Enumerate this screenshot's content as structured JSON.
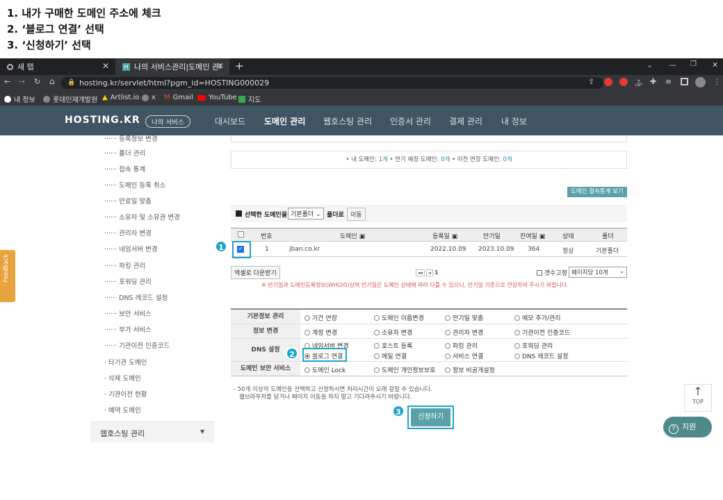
{
  "instructions": [
    "1. 내가 구매한 도메인 주소에 체크",
    "2. ‘블로그 연결’ 선택",
    "3. ‘신청하기’ 선택"
  ],
  "browser": {
    "tabs": [
      {
        "title": "새 탭"
      },
      {
        "title": "나의 서비스관리|도메인 관리|보"
      }
    ],
    "url": "hosting.kr/servlet/html?pgm_id=HOSTING000029",
    "bookmarks": [
      "내 정보",
      "롯데인재개발원",
      "Artlist.io",
      "x",
      "Gmail",
      "YouTube",
      "지도"
    ]
  },
  "site": {
    "logo": "HOSTING.KR",
    "logo_tag": "나의 서비스",
    "nav": [
      "대시보드",
      "도메인 관리",
      "웹호스팅 관리",
      "인증서 관리",
      "결제 관리",
      "내 정보"
    ],
    "nav_active": "도메인 관리"
  },
  "sidebar": {
    "items": [
      "······ 등록정보 변경",
      "······ 폴더 관리",
      "······ 접속 통계",
      "······ 도메인 등록 취소",
      "······ 만료일 맞춤",
      "······ 소유자 및 소유권 변경",
      "······ 관리자 변경",
      "······ 네임서버 변경",
      "······ 파킹 관리",
      "······ 포워딩 관리",
      "······ DNS 레코드 설정",
      "······ 보안 서비스",
      "······ 부가 서비스",
      "······ 기관이전 인증코드",
      "타기관 도메인",
      "삭제 도메인",
      "기관이전 현황",
      "예약 도메인"
    ],
    "bottom": "웹호스팅 관리"
  },
  "feedback_tab": "Feedback",
  "summary": {
    "prefix": "• 내 도메인: ",
    "count1": "1개",
    "mid": " • 만기 예정 도메인: ",
    "count2": "0개",
    "mid2": " • 이전 연장 도메인: ",
    "count3": "0개"
  },
  "stats_button": "도메인 접속통계 보기",
  "folder_bar": {
    "label": "선택한 도메인을",
    "select": "기본폴더",
    "suffix": "폴더로",
    "move": "이동"
  },
  "table": {
    "headers": [
      "번호",
      "도메인",
      "등록일",
      "만기일",
      "잔여일",
      "상태",
      "폴더"
    ],
    "rows": [
      {
        "no": "1",
        "domain": "jban.co.kr",
        "reg": "2022.10.09",
        "exp": "2023.10.09",
        "remain": "364",
        "status": "정상",
        "folder": "기본폴더"
      }
    ]
  },
  "excel_button": "엑셀로 다운받기",
  "pager": {
    "page": "1"
  },
  "fix_count": "갯수고정",
  "per_page": "페이지당 10개",
  "notice": "※ 만기일과 도메인등록정보(WHOIS)상의 만기일은 도메인 상태에 따라 다를 수 있으니, 만기일 기준으로 연장하여 주시기 바랍니다.",
  "services": [
    {
      "label": "기본정보 관리",
      "options": [
        "기간 연장",
        "도메인 이름변경",
        "만기일 맞춤",
        "메모 추가/관리"
      ]
    },
    {
      "label": "정보 변경",
      "options": [
        "계정 변경",
        "소유자 변경",
        "관리자 변경",
        "기관이전 인증코드"
      ]
    },
    {
      "label": "DNS 설정",
      "options": [
        "네임서버 변경",
        "호스트 등록",
        "파킹 관리",
        "포워딩 관리",
        "블로그 연결",
        "메일 연결",
        "서비스 연결",
        "DNS 레코드 설정"
      ]
    },
    {
      "label": "도메인 보안 서비스",
      "options": [
        "도메인 Lock",
        "도메인 개인정보보호",
        "정보 비공개설정"
      ]
    }
  ],
  "selected_option": "블로그 연결",
  "footnote": [
    "- 50개 이상의 도메인을 선택하고 신청하시면 처리시간이 오래 걸릴 수 있습니다.",
    "웹브라우저를 닫거나 페이지 이동을 하지 말고 기다려주시기 바랍니다."
  ],
  "submit": "신청하기",
  "top_button": "TOP",
  "support_button": "지원",
  "badges": [
    "1",
    "2",
    "3"
  ],
  "colors": {
    "nav_bg": "#3f5563",
    "accent": "#5aa0a8",
    "highlight": "#1aa3d1",
    "notice": "#d9534f"
  }
}
